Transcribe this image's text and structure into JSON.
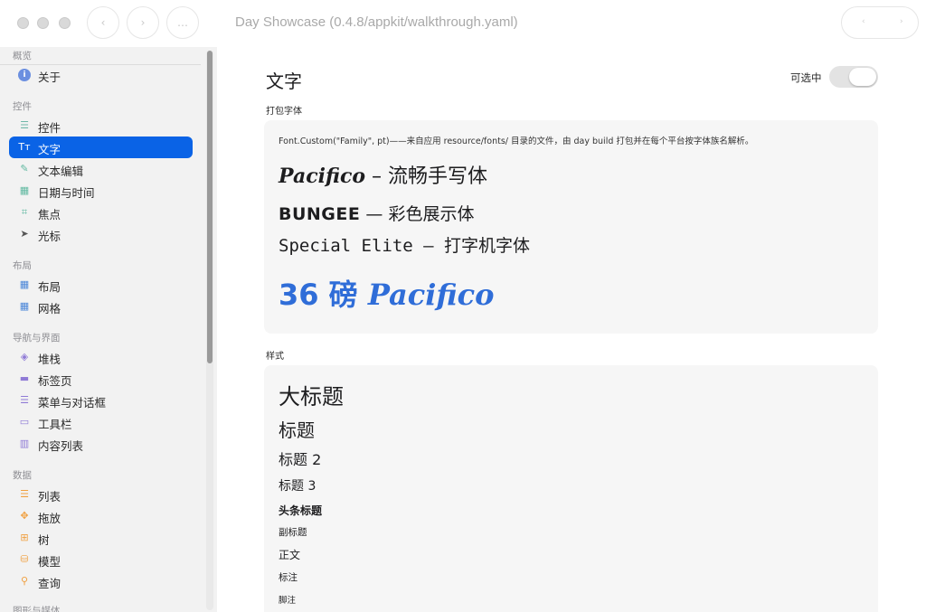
{
  "window": {
    "title": "Day Showcase (0.4.8/appkit/walkthrough.yaml)",
    "back_glyph": "‹",
    "forward_glyph": "›",
    "more_glyph": "…",
    "pill_left": "‹",
    "pill_right": "›"
  },
  "sidebar": {
    "sections": [
      {
        "label": "概览",
        "items": [
          {
            "label": "关于",
            "icon": "info-icon",
            "glyph": "i",
            "color": "#6b8fe0"
          }
        ]
      },
      {
        "label": "控件",
        "items": [
          {
            "label": "控件",
            "icon": "sliders-icon",
            "glyph": "☰",
            "color": "#6fb7a8"
          },
          {
            "label": "文字",
            "icon": "text-icon",
            "glyph": "Tт",
            "color": "#ffffff",
            "selected": true
          },
          {
            "label": "文本编辑",
            "icon": "doc-edit-icon",
            "glyph": "✎",
            "color": "#5fb8a0"
          },
          {
            "label": "日期与时间",
            "icon": "calendar-icon",
            "glyph": "▦",
            "color": "#5fb8a0"
          },
          {
            "label": "焦点",
            "icon": "focus-icon",
            "glyph": "⌗",
            "color": "#5fb8a0"
          },
          {
            "label": "光标",
            "icon": "cursor-icon",
            "glyph": "➤",
            "color": "#555555"
          }
        ]
      },
      {
        "label": "布局",
        "items": [
          {
            "label": "布局",
            "icon": "layout-icon",
            "glyph": "▦",
            "color": "#4a86d8"
          },
          {
            "label": "网格",
            "icon": "grid-icon",
            "glyph": "▦",
            "color": "#4a86d8"
          }
        ]
      },
      {
        "label": "导航与界面",
        "items": [
          {
            "label": "堆栈",
            "icon": "stack-icon",
            "glyph": "◈",
            "color": "#8f7ad6"
          },
          {
            "label": "标签页",
            "icon": "tabs-icon",
            "glyph": "▬",
            "color": "#8f7ad6"
          },
          {
            "label": "菜单与对话框",
            "icon": "menu-icon",
            "glyph": "☰",
            "color": "#8f7ad6"
          },
          {
            "label": "工具栏",
            "icon": "toolbar-icon",
            "glyph": "▭",
            "color": "#8f7ad6"
          },
          {
            "label": "内容列表",
            "icon": "columns-icon",
            "glyph": "▥",
            "color": "#8f7ad6"
          }
        ]
      },
      {
        "label": "数据",
        "items": [
          {
            "label": "列表",
            "icon": "list-icon",
            "glyph": "☰",
            "color": "#f0a040"
          },
          {
            "label": "拖放",
            "icon": "drag-move-icon",
            "glyph": "✥",
            "color": "#f0a040"
          },
          {
            "label": "树",
            "icon": "tree-icon",
            "glyph": "⊞",
            "color": "#f0a040"
          },
          {
            "label": "模型",
            "icon": "database-icon",
            "glyph": "⛁",
            "color": "#f0a040"
          },
          {
            "label": "查询",
            "icon": "search-icon",
            "glyph": "⚲",
            "color": "#f0a040"
          }
        ]
      },
      {
        "label": "图形与媒体",
        "items": []
      }
    ]
  },
  "main": {
    "title": "文字",
    "selectable_label": "可选中",
    "selectable_on": false,
    "packaged_fonts": {
      "heading": "打包字体",
      "note": "Font.Custom(\"Family\", pt)——来自应用 resource/fonts/ 目录的文件，由 day build 打包并在每个平台按字体族名解析。",
      "pacifico_name": "Pacifico",
      "pacifico_desc": " – 流畅手写体",
      "bungee_name": "BUNGEE",
      "bungee_desc": " — 彩色展示体",
      "special_elite": "Special Elite — 打字机字体",
      "big_prefix": "36 磅 ",
      "big_script": "Pacifico"
    },
    "styles": {
      "heading": "样式",
      "items": [
        "大标题",
        "标题",
        "标题 2",
        "标题 3",
        "头条标题",
        "副标题",
        "正文",
        "标注",
        "脚注"
      ]
    }
  }
}
